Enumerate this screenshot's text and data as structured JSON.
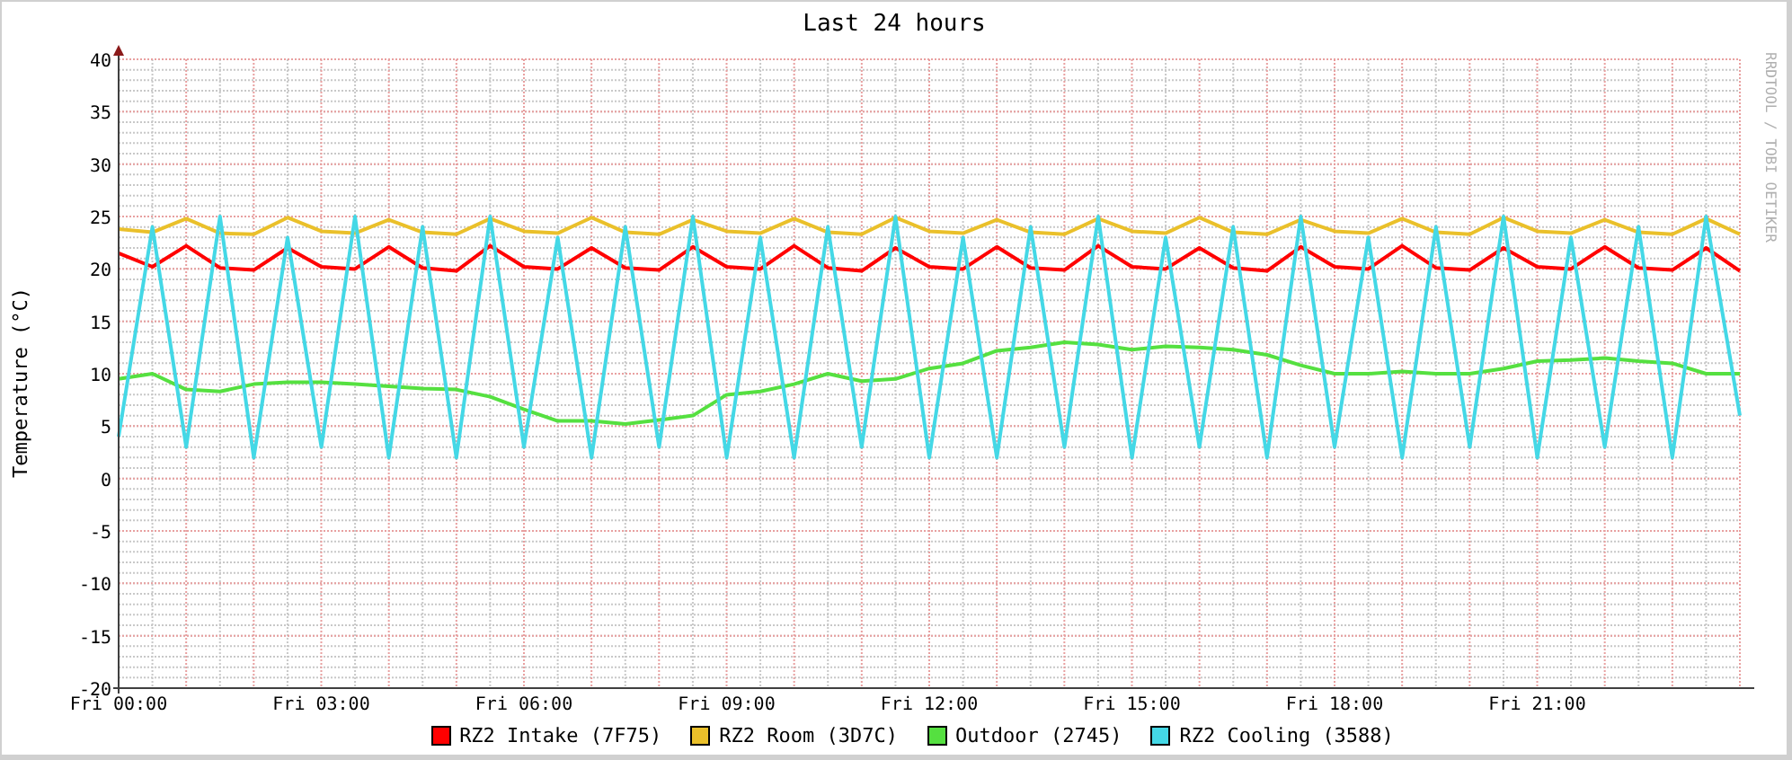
{
  "chart": {
    "credit": "RRDTOOL / TOBI OETIKER",
    "chart_data": {
      "type": "line",
      "title": "Last 24 hours",
      "ylabel": "Temperature (°C)",
      "categories": [
        "Fri 00:00",
        null,
        null,
        null,
        null,
        null,
        "Fri 03:00",
        null,
        null,
        null,
        null,
        null,
        "Fri 06:00",
        null,
        null,
        null,
        null,
        null,
        "Fri 09:00",
        null,
        null,
        null,
        null,
        null,
        "Fri 12:00",
        null,
        null,
        null,
        null,
        null,
        "Fri 15:00",
        null,
        null,
        null,
        null,
        null,
        "Fri 18:00",
        null,
        null,
        null,
        null,
        null,
        "Fri 21:00",
        null,
        null,
        null,
        null,
        null,
        null
      ],
      "ylim": [
        -20,
        40
      ],
      "grid": true,
      "yticks": [
        -20,
        -15,
        -10,
        -5,
        0,
        5,
        10,
        15,
        20,
        25,
        30,
        35,
        40
      ],
      "series": [
        {
          "name": "RZ2 Intake (7F75)",
          "color": "#ff0000",
          "values": [
            21.5,
            20.2,
            22.2,
            20.1,
            19.9,
            22.0,
            20.2,
            20.0,
            22.1,
            20.1,
            19.8,
            22.2,
            20.2,
            20.0,
            22.0,
            20.1,
            19.9,
            22.1,
            20.2,
            20.0,
            22.2,
            20.1,
            19.8,
            22.0,
            20.2,
            20.0,
            22.1,
            20.1,
            19.9,
            22.2,
            20.2,
            20.0,
            22.0,
            20.1,
            19.8,
            22.1,
            20.2,
            20.0,
            22.2,
            20.1,
            19.9,
            22.0,
            20.2,
            20.0,
            22.1,
            20.1,
            19.9,
            22.0,
            19.8
          ]
        },
        {
          "name": "RZ2 Room (3D7C)",
          "color": "#eac02a",
          "values": [
            23.8,
            23.5,
            24.8,
            23.4,
            23.3,
            24.9,
            23.6,
            23.4,
            24.7,
            23.5,
            23.3,
            24.8,
            23.6,
            23.4,
            24.9,
            23.5,
            23.3,
            24.7,
            23.6,
            23.4,
            24.8,
            23.5,
            23.3,
            24.9,
            23.6,
            23.4,
            24.7,
            23.5,
            23.3,
            24.8,
            23.6,
            23.4,
            24.9,
            23.5,
            23.3,
            24.7,
            23.6,
            23.4,
            24.8,
            23.5,
            23.3,
            24.9,
            23.6,
            23.4,
            24.7,
            23.5,
            23.3,
            24.8,
            23.3
          ]
        },
        {
          "name": "Outdoor (2745)",
          "color": "#55e040",
          "values": [
            9.5,
            10,
            8.5,
            8.3,
            9,
            9.2,
            9.2,
            9,
            8.8,
            8.6,
            8.5,
            7.8,
            6.6,
            5.5,
            5.5,
            5.2,
            5.6,
            6,
            8,
            8.3,
            9,
            10,
            9.3,
            9.5,
            10.5,
            11,
            12.2,
            12.5,
            13,
            12.8,
            12.3,
            12.6,
            12.5,
            12.3,
            11.8,
            10.8,
            10,
            10,
            10.2,
            10,
            10,
            10.5,
            11.2,
            11.3,
            11.5,
            11.2,
            11,
            10,
            10
          ]
        },
        {
          "name": "RZ2 Cooling (3588)",
          "color": "#44d8e6",
          "values": [
            4,
            24,
            3,
            25,
            2,
            23,
            3,
            25,
            2,
            24,
            2,
            25,
            3,
            23,
            2,
            24,
            3,
            25,
            2,
            23,
            2,
            24,
            3,
            25,
            2,
            23,
            2,
            24,
            3,
            25,
            2,
            23,
            3,
            24,
            2,
            25,
            3,
            23,
            2,
            24,
            3,
            25,
            2,
            23,
            3,
            24,
            2,
            25,
            6
          ]
        }
      ]
    }
  }
}
